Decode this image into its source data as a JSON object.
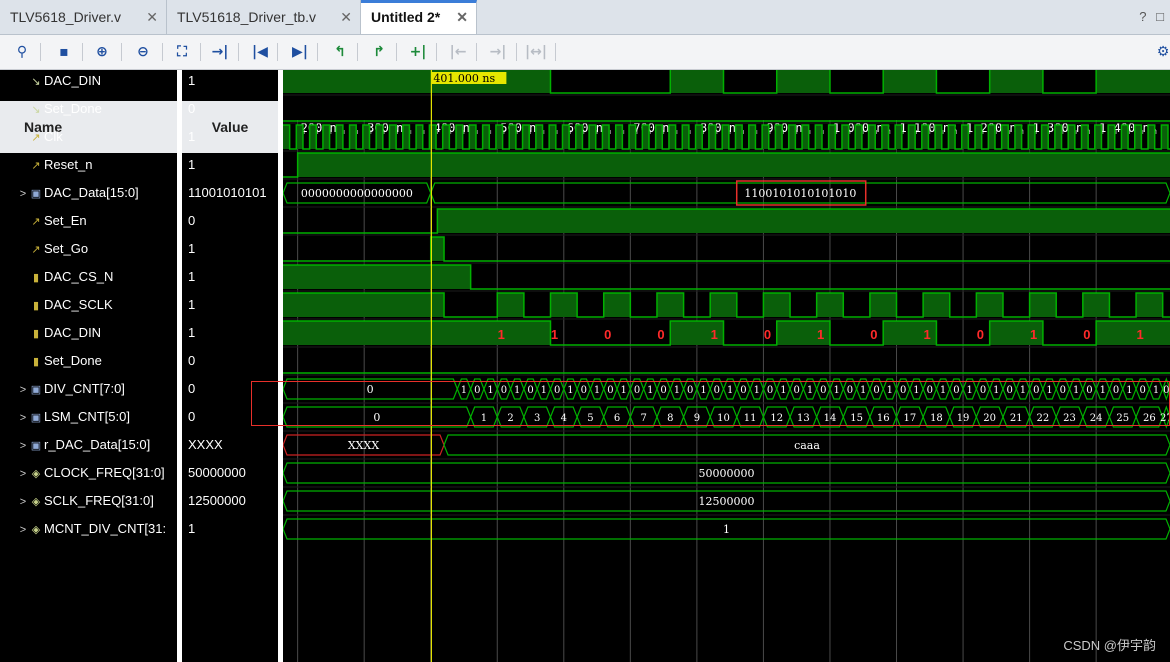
{
  "tabs": [
    {
      "label": "TLV5618_Driver.v",
      "active": false
    },
    {
      "label": "TLV51618_Driver_tb.v",
      "active": false
    },
    {
      "label": "Untitled 2*",
      "active": true
    }
  ],
  "window_controls": [
    "?",
    "□"
  ],
  "toolbar_icons": [
    "search-icon",
    "save-icon",
    "zoom-in-icon",
    "zoom-out-icon",
    "zoom-fit-icon",
    "go-to-cursor-icon",
    "go-to-start-icon",
    "go-to-end-icon",
    "previous-transition-icon",
    "next-transition-icon",
    "add-marker-icon",
    "previous-marker-icon",
    "next-marker-icon",
    "swap-cursors-icon"
  ],
  "columns": {
    "name": "Name",
    "value": "Value"
  },
  "cursor": {
    "time_label": "401.000 ns",
    "time_ns": 401
  },
  "timeline": {
    "ticks": [
      "200 ns",
      "300 ns",
      "400 ns",
      "500 ns",
      "600 ns",
      "700 ns",
      "800 ns",
      "900 ns",
      "1,000 ns",
      "1,100 ns",
      "1,200 ns",
      "1,300 ns",
      "1,400 ns"
    ],
    "tick_ns": [
      200,
      300,
      400,
      500,
      600,
      700,
      800,
      900,
      1000,
      1100,
      1200,
      1300,
      1400
    ],
    "view_start_ns": 178,
    "view_end_ns": 1511
  },
  "signals": [
    {
      "name": "DAC_DIN",
      "value": "1",
      "icon": "output-port-icon",
      "bus": false
    },
    {
      "name": "Set_Done",
      "value": "0",
      "icon": "output-port-icon",
      "bus": false
    },
    {
      "name": "Clk",
      "value": "1",
      "icon": "input-port-icon",
      "bus": false
    },
    {
      "name": "Reset_n",
      "value": "1",
      "icon": "input-port-icon",
      "bus": false
    },
    {
      "name": "DAC_Data[15:0]",
      "value": "11001010101",
      "icon": "bus-icon",
      "bus": true
    },
    {
      "name": "Set_En",
      "value": "0",
      "icon": "input-port-icon",
      "bus": false
    },
    {
      "name": "Set_Go",
      "value": "1",
      "icon": "input-port-icon",
      "bus": false
    },
    {
      "name": "DAC_CS_N",
      "value": "1",
      "icon": "signal-icon",
      "bus": false
    },
    {
      "name": "DAC_SCLK",
      "value": "1",
      "icon": "signal-icon",
      "bus": false
    },
    {
      "name": "DAC_DIN",
      "value": "1",
      "icon": "signal-icon",
      "bus": false
    },
    {
      "name": "Set_Done",
      "value": "0",
      "icon": "signal-icon",
      "bus": false
    },
    {
      "name": "DIV_CNT[7:0]",
      "value": "0",
      "icon": "bus-icon",
      "bus": true
    },
    {
      "name": "LSM_CNT[5:0]",
      "value": "0",
      "icon": "bus-icon",
      "bus": true
    },
    {
      "name": "r_DAC_Data[15:0]",
      "value": "XXXX",
      "icon": "bus-icon",
      "bus": true
    },
    {
      "name": "CLOCK_FREQ[31:0]",
      "value": "50000000",
      "icon": "param-icon",
      "bus": true
    },
    {
      "name": "SCLK_FREQ[31:0]",
      "value": "12500000",
      "icon": "param-icon",
      "bus": true
    },
    {
      "name": "MCNT_DIV_CNT[31:",
      "value": "1",
      "icon": "param-icon",
      "bus": true
    }
  ],
  "bus_labels": {
    "dac_data_before": "0000000000000000",
    "dac_data_after": "1100101010101010",
    "r_dac_data_before": "XXXX",
    "r_dac_data_after": "caaa",
    "clock_freq": "50000000",
    "sclk_freq": "12500000",
    "mcnt_div_cnt": "1",
    "div_cnt_initial": "0",
    "lsm_cnt_initial": "0"
  },
  "din_annotations": [
    "1",
    "1",
    "0",
    "0",
    "1",
    "0",
    "1",
    "0",
    "1",
    "0",
    "1",
    "0",
    "1"
  ],
  "watermark": "CSDN @伊宇韵",
  "colors": {
    "wave": "#00b000",
    "wave_fill": "#0a5f0a",
    "cursor": "#e6e600",
    "highlight_box": "#e8302a",
    "annotation": "#ff2a2a",
    "bus_x": "#cc2222"
  }
}
